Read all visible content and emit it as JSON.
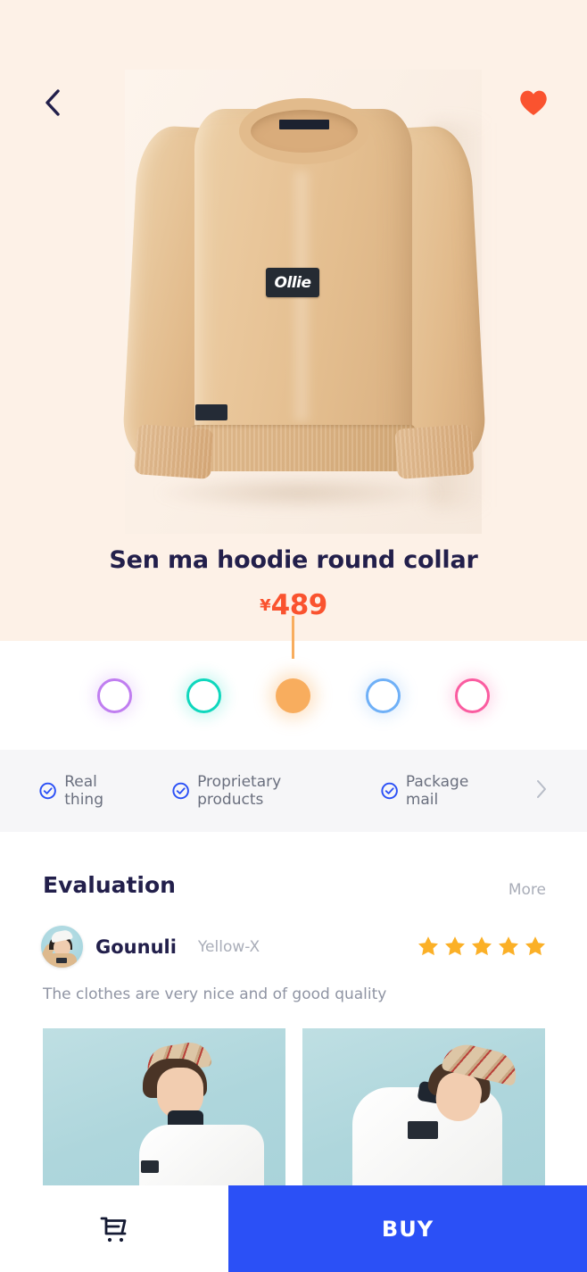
{
  "header": {
    "back_icon": "chevron-left-icon",
    "favorite_icon": "heart-icon",
    "favorite_color": "#fa532f"
  },
  "product": {
    "title": "Sen ma hoodie round collar",
    "currency_symbol": "¥",
    "price": "489",
    "image_alt": "beige crewneck sweatshirt with Ollie box logo",
    "brand_patch": "Ollie",
    "background_color": "#fdf1e7",
    "price_color": "#fa532f",
    "title_color": "#221f4b"
  },
  "colors": {
    "selected_index": 2,
    "options": [
      {
        "name": "purple",
        "hex": "#c07ef0"
      },
      {
        "name": "teal",
        "hex": "#0fd7bd"
      },
      {
        "name": "orange",
        "hex": "#f8ad5e"
      },
      {
        "name": "blue",
        "hex": "#6fb0f7"
      },
      {
        "name": "pink",
        "hex": "#fa5ca0"
      }
    ]
  },
  "features": {
    "items": [
      {
        "label": "Real thing",
        "icon": "check-circle-icon"
      },
      {
        "label": "Proprietary products",
        "icon": "check-circle-icon"
      },
      {
        "label": "Package mail",
        "icon": "check-circle-icon"
      }
    ],
    "chevron_icon": "chevron-right-icon",
    "icon_color": "#2b50f6"
  },
  "evaluation": {
    "heading": "Evaluation",
    "more_label": "More",
    "review": {
      "avatar_icon": "user-avatar",
      "name": "Gounuli",
      "variant": "Yellow-X",
      "rating": 5,
      "max_rating": 5,
      "star_color": "#fbb027",
      "text": "The clothes are very nice and of good quality",
      "photos": [
        {
          "alt": "model wearing white sweatshirt with plaid cap, smiling"
        },
        {
          "alt": "model looking down wearing white Ollie sweatshirt with plaid cap"
        }
      ]
    }
  },
  "bottom_bar": {
    "cart_icon": "shopping-cart-icon",
    "buy_label": "BUY",
    "buy_color": "#2b50f6"
  }
}
